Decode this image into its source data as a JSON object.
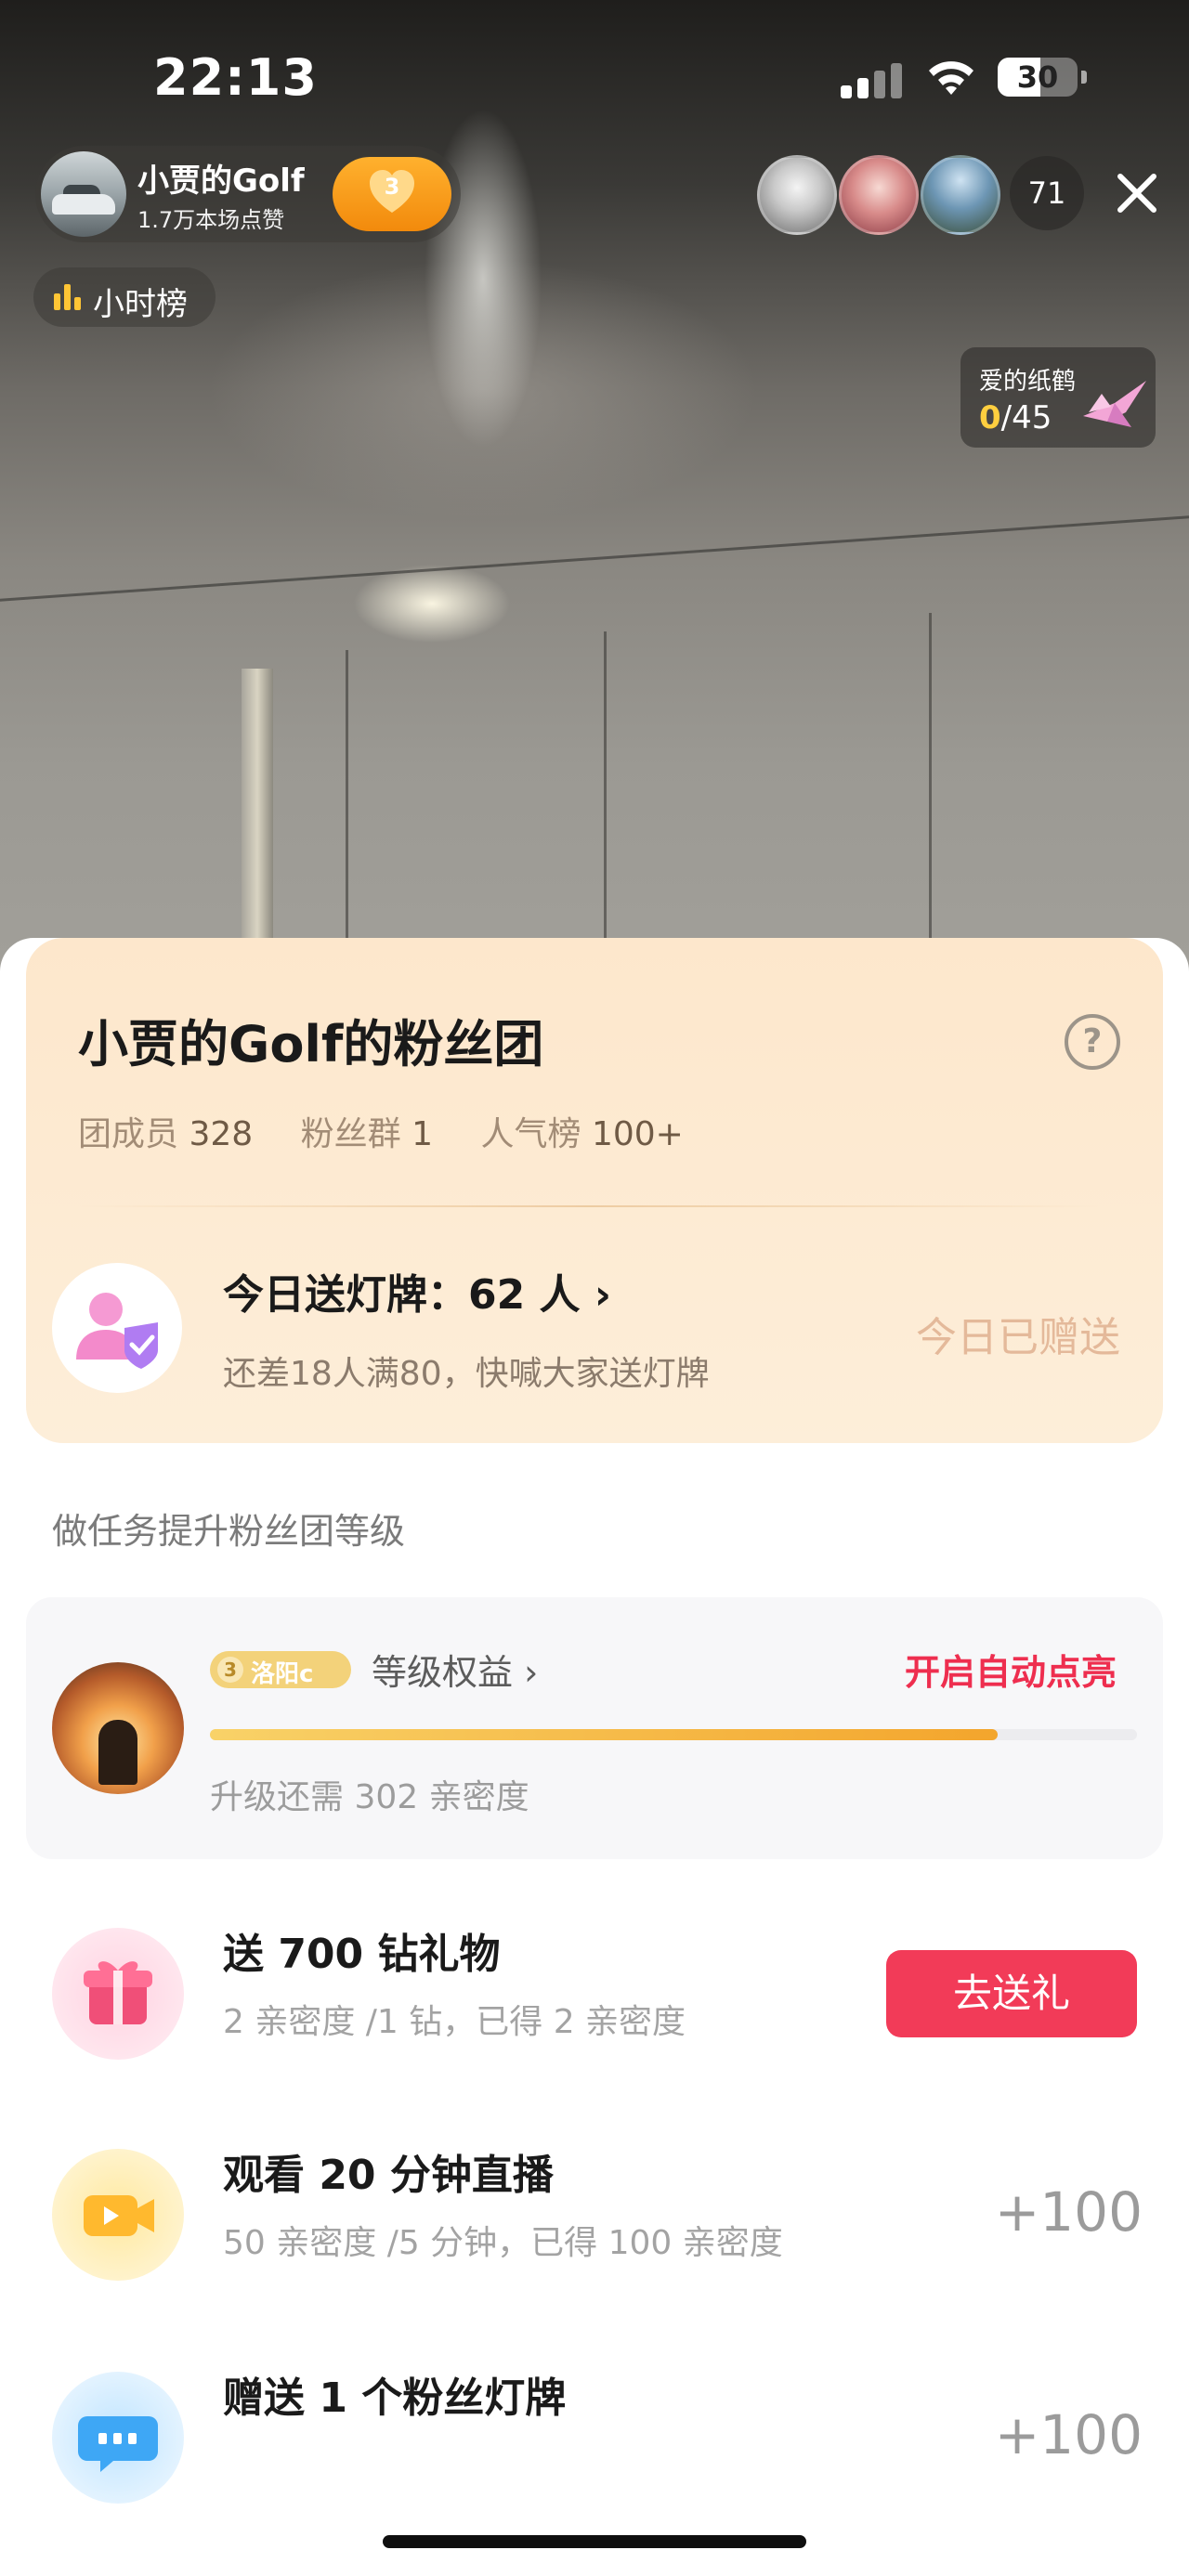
{
  "status_bar": {
    "time": "22:13",
    "battery": "30"
  },
  "host": {
    "name": "小贾的Golf",
    "likes": "1.7万本场点赞",
    "fan_level": "3"
  },
  "viewers": {
    "count": "71"
  },
  "rank": {
    "label": "小时榜"
  },
  "crane": {
    "title": "爱的纸鹤",
    "current": "0",
    "total": "/45"
  },
  "fan_club": {
    "title": "小贾的Golf的粉丝团",
    "help": "?",
    "stats": [
      {
        "label": "团成员",
        "value": "328"
      },
      {
        "label": "粉丝群",
        "value": "1"
      },
      {
        "label": "人气榜",
        "value": "100+"
      }
    ],
    "lamp_title": "今日送灯牌：62 人",
    "lamp_subtitle": "还差18人满80，快喊大家送灯牌",
    "lamp_status": "今日已赠送"
  },
  "section_label": "做任务提升粉丝团等级",
  "level": {
    "badge_num": "3",
    "badge_name": "洛阳c",
    "rights": "等级权益",
    "auto_light": "开启自动点亮",
    "progress": 0.85,
    "need": "升级还需 302 亲密度"
  },
  "tasks": [
    {
      "title": "送 700 钻礼物",
      "subtitle": "2 亲密度 /1 钻，已得 2 亲密度",
      "button": "去送礼",
      "icon": "gift-icon"
    },
    {
      "title": "观看 20 分钟直播",
      "subtitle": "50 亲密度 /5 分钟，已得 100 亲密度",
      "reward": "+100",
      "icon": "video-camera-icon"
    },
    {
      "title": "赠送 1 个粉丝灯牌",
      "reward": "+100",
      "icon": "chat-bubble-icon"
    }
  ],
  "colors": {
    "accent_red": "#f23b58",
    "progress_gold": "#f3a52c",
    "fan_card_bg": "#fde7cc"
  }
}
